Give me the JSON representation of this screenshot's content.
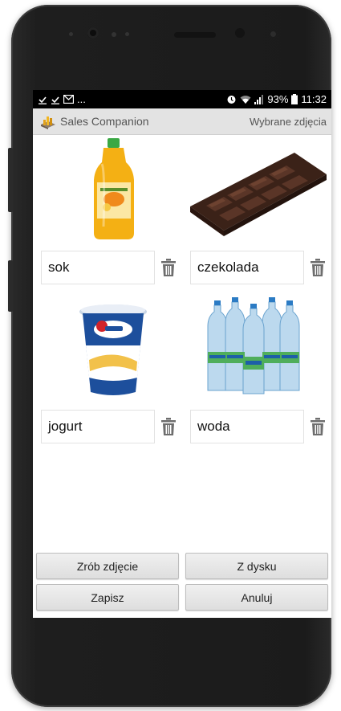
{
  "status_bar": {
    "left_icons": [
      "download-done-icon",
      "download-done-icon",
      "email-icon"
    ],
    "left_more": "...",
    "battery_percent": "93%",
    "time": "11:32"
  },
  "app_bar": {
    "title": "Sales Companion",
    "subtitle": "Wybrane zdjęcia"
  },
  "items": [
    {
      "label": "sok",
      "image": "orange-juice-bottle"
    },
    {
      "label": "czekolada",
      "image": "chocolate-bar"
    },
    {
      "label": "jogurt",
      "image": "yogurt-cup"
    },
    {
      "label": "woda",
      "image": "water-bottles"
    }
  ],
  "buttons": {
    "take_photo": "Zrób zdjęcie",
    "from_disk": "Z dysku",
    "save": "Zapisz",
    "cancel": "Anuluj"
  },
  "colors": {
    "status_bar": "#000000",
    "app_bar": "#e3e3e3",
    "button": "#e6e6e6"
  }
}
